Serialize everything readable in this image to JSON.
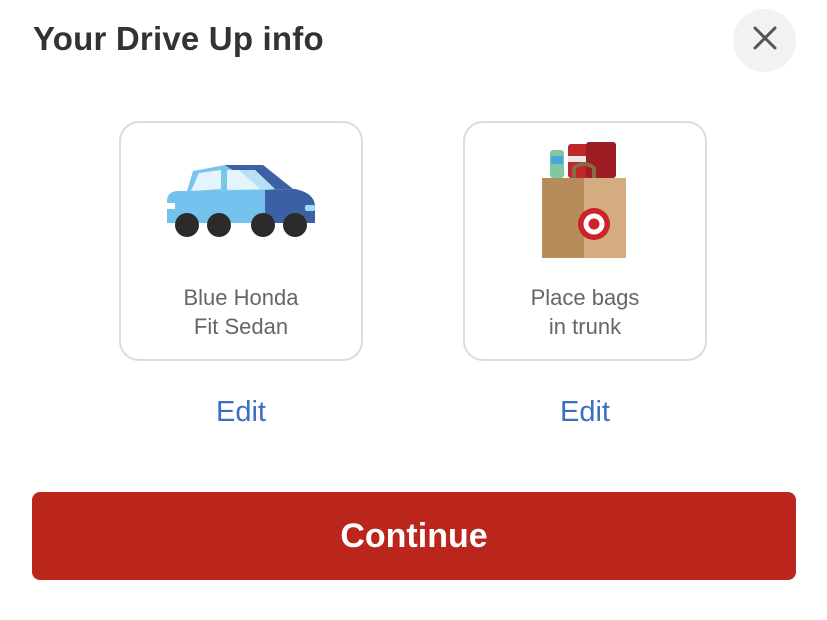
{
  "dialog": {
    "title": "Your Drive Up info",
    "close_icon": "close-icon"
  },
  "vehicle": {
    "icon": "car-icon",
    "line1": "Blue Honda",
    "line2": "Fit Sedan",
    "edit_label": "Edit"
  },
  "pickup": {
    "icon": "shopping-bag-icon",
    "line1": "Place bags",
    "line2": "in trunk",
    "edit_label": "Edit"
  },
  "continue_label": "Continue",
  "colors": {
    "accent_red": "#bb261c",
    "link_blue": "#3a6fc4",
    "card_border": "#dcdcdc",
    "text_dark": "#333333",
    "text_muted": "#666666"
  }
}
